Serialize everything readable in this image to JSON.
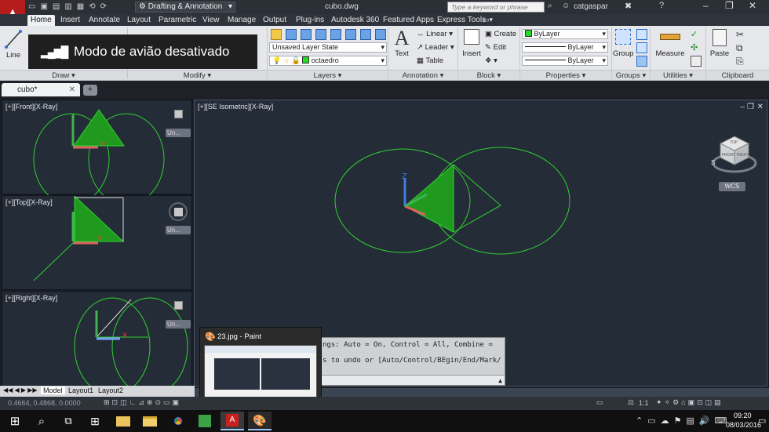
{
  "titlebar": {
    "workspace": "Drafting & Annotation",
    "document": "cubo.dwg",
    "search_placeholder": "Type a keyword or phrase",
    "user": "catgaspar"
  },
  "ribbon_tabs": [
    "Home",
    "Insert",
    "Annotate",
    "Layout",
    "Parametric",
    "View",
    "Manage",
    "Output",
    "Plug-ins",
    "Autodesk 360",
    "Featured Apps",
    "Express Tools"
  ],
  "panels": {
    "draw": {
      "label": "Draw",
      "line": "Line"
    },
    "modify": {
      "label": "Modify"
    },
    "layers": {
      "label": "Layers",
      "layer_state": "Unsaved Layer State",
      "current_layer": "octaedro"
    },
    "annotation": {
      "label": "Annotation",
      "text": "Text",
      "linear": "Linear",
      "leader": "Leader",
      "table": "Table"
    },
    "block": {
      "label": "Block",
      "insert": "Insert",
      "create": "Create",
      "edit": "Edit"
    },
    "properties": {
      "label": "Properties",
      "color": "ByLayer",
      "linetype": "ByLayer",
      "lineweight": "ByLayer"
    },
    "groups": {
      "label": "Groups",
      "group": "Group"
    },
    "utilities": {
      "label": "Utilities",
      "measure": "Measure"
    },
    "clipboard": {
      "label": "Clipboard",
      "paste": "Paste"
    }
  },
  "toast": {
    "text": "Modo de avião desativado"
  },
  "document_tab": "cubo*",
  "viewports": {
    "front": "[+][Front][X-Ray]",
    "top": "[+][Top][X-Ray]",
    "right": "[+][Right][X-Ray]",
    "main": "[+][SE Isometric][X-Ray]",
    "unnamed": "Un...",
    "wcs": "WCS",
    "viewcube_top": "TOP",
    "viewcube_front": "FRONT",
    "viewcube_right": "RIGHT",
    "compass_s": "S"
  },
  "command_line": {
    "line1": "ngs: Auto = On, Control = All, Combine =",
    "line2": "s to undo or [Auto/Control/BEgin/End/Mark/"
  },
  "thumbnail": {
    "title": "23.jpg - Paint"
  },
  "layout_tabs": [
    "Model",
    "Layout1",
    "Layout2"
  ],
  "status": {
    "coords": "0.4664, 0.4868, 0.0000",
    "scale": "1:1"
  },
  "taskbar": {
    "time": "09:20",
    "date": "08/03/2016"
  },
  "colors": {
    "accent_red": "#c8201e",
    "geometry": "#2fd12f",
    "fill": "#1f9a1f"
  }
}
